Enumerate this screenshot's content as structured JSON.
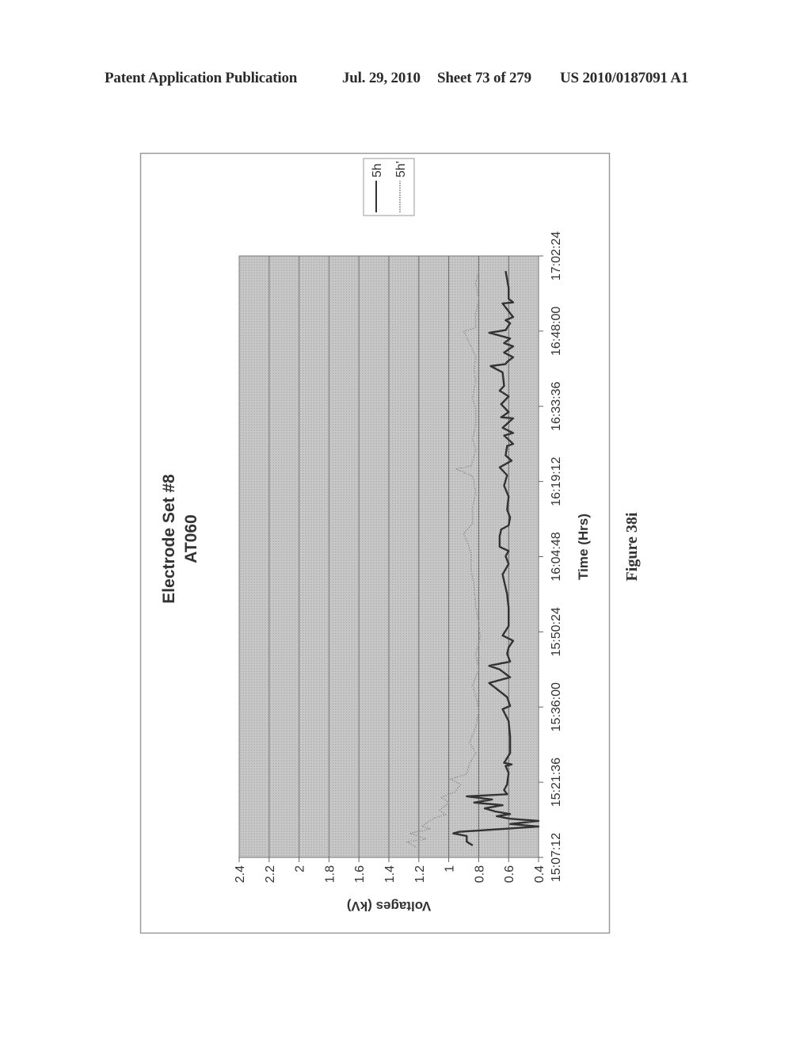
{
  "header": {
    "publication": "Patent Application Publication",
    "date": "Jul. 29, 2010",
    "sheet": "Sheet 73 of 279",
    "number": "US 2010/0187091 A1"
  },
  "figure": {
    "caption": "Figure 38i"
  },
  "chart_data": {
    "type": "line",
    "title": [
      "Electrode Set #8",
      "AT060"
    ],
    "xlabel": "Time (Hrs)",
    "ylabel": "Voltages (kV)",
    "x_origin": "15:07:12",
    "x_unit": "minutes after 15:07:12",
    "xlim": [
      0,
      115.2
    ],
    "x_ticks": [
      {
        "label": "15:07:12",
        "value": 0
      },
      {
        "label": "15:21:36",
        "value": 14.4
      },
      {
        "label": "15:36:00",
        "value": 28.8
      },
      {
        "label": "15:50:24",
        "value": 43.2
      },
      {
        "label": "16:04:48",
        "value": 57.6
      },
      {
        "label": "16:19:12",
        "value": 72.0
      },
      {
        "label": "16:33:36",
        "value": 86.4
      },
      {
        "label": "16:48:00",
        "value": 100.8
      },
      {
        "label": "17:02:24",
        "value": 115.2
      }
    ],
    "ylim": [
      0.4,
      2.4
    ],
    "y_ticks": [
      2.4,
      2.2,
      2,
      1.8,
      1.6,
      1.4,
      1.2,
      1,
      0.8,
      0.6,
      0.4
    ],
    "grid": "horizontal major gridlines",
    "legend": {
      "position": "top-right",
      "entries": [
        "5h",
        "5h'"
      ]
    },
    "series": [
      {
        "name": "5h",
        "style": "solid",
        "color": "#333333",
        "points": [
          [
            2.3,
            0.84
          ],
          [
            3.0,
            0.88
          ],
          [
            4.1,
            0.88
          ],
          [
            4.6,
            0.97
          ],
          [
            4.9,
            0.93
          ],
          [
            5.9,
            0.4
          ],
          [
            6.4,
            0.59
          ],
          [
            7.0,
            0.4
          ],
          [
            7.4,
            0.59
          ],
          [
            7.9,
            0.68
          ],
          [
            8.3,
            0.59
          ],
          [
            8.8,
            0.69
          ],
          [
            9.4,
            0.76
          ],
          [
            10.0,
            0.64
          ],
          [
            10.5,
            0.83
          ],
          [
            11.1,
            0.71
          ],
          [
            11.7,
            0.88
          ],
          [
            12.1,
            0.61
          ],
          [
            12.9,
            0.63
          ],
          [
            14.0,
            0.61
          ],
          [
            16.2,
            0.6
          ],
          [
            17.5,
            0.62
          ],
          [
            17.8,
            0.58
          ],
          [
            18.1,
            0.63
          ],
          [
            20.0,
            0.59
          ],
          [
            23.1,
            0.59
          ],
          [
            26.1,
            0.6
          ],
          [
            28.4,
            0.64
          ],
          [
            29.0,
            0.59
          ],
          [
            30.7,
            0.61
          ],
          [
            33.4,
            0.73
          ],
          [
            34.5,
            0.59
          ],
          [
            36.0,
            0.66
          ],
          [
            36.7,
            0.73
          ],
          [
            37.5,
            0.59
          ],
          [
            39.0,
            0.61
          ],
          [
            40.2,
            0.6
          ],
          [
            41.5,
            0.57
          ],
          [
            42.5,
            0.64
          ],
          [
            44.3,
            0.6
          ],
          [
            47.8,
            0.6
          ],
          [
            50.4,
            0.61
          ],
          [
            54.2,
            0.64
          ],
          [
            56.2,
            0.6
          ],
          [
            57.7,
            0.62
          ],
          [
            58.7,
            0.6
          ],
          [
            59.5,
            0.66
          ],
          [
            61.5,
            0.66
          ],
          [
            62.8,
            0.65
          ],
          [
            63.6,
            0.6
          ],
          [
            65.1,
            0.59
          ],
          [
            66.6,
            0.61
          ],
          [
            69.1,
            0.6
          ],
          [
            71.2,
            0.63
          ],
          [
            73.2,
            0.61
          ],
          [
            74.7,
            0.66
          ],
          [
            76.0,
            0.58
          ],
          [
            77.0,
            0.62
          ],
          [
            78.8,
            0.61
          ],
          [
            79.2,
            0.57
          ],
          [
            80.8,
            0.63
          ],
          [
            81.3,
            0.57
          ],
          [
            82.3,
            0.64
          ],
          [
            84.1,
            0.57
          ],
          [
            84.3,
            0.65
          ],
          [
            85.3,
            0.6
          ],
          [
            86.8,
            0.65
          ],
          [
            88.3,
            0.6
          ],
          [
            89.4,
            0.66
          ],
          [
            90.3,
            0.63
          ],
          [
            92.9,
            0.64
          ],
          [
            94.1,
            0.72
          ],
          [
            94.5,
            0.62
          ],
          [
            94.9,
            0.61
          ],
          [
            95.8,
            0.57
          ],
          [
            96.7,
            0.63
          ],
          [
            97.9,
            0.57
          ],
          [
            98.5,
            0.63
          ],
          [
            99.4,
            0.59
          ],
          [
            100.5,
            0.73
          ],
          [
            101.0,
            0.62
          ],
          [
            102.3,
            0.59
          ],
          [
            102.9,
            0.62
          ],
          [
            103.5,
            0.57
          ],
          [
            106.1,
            0.64
          ],
          [
            106.3,
            0.57
          ],
          [
            107.0,
            0.6
          ],
          [
            109.1,
            0.6
          ],
          [
            110.7,
            0.61
          ],
          [
            112.3,
            0.62
          ]
        ]
      },
      {
        "name": "5h'",
        "style": "dotted",
        "color": "#9a9a9a",
        "points": [
          [
            2.0,
            1.22
          ],
          [
            3.0,
            1.28
          ],
          [
            3.5,
            1.15
          ],
          [
            4.6,
            1.26
          ],
          [
            5.5,
            1.12
          ],
          [
            6.0,
            1.18
          ],
          [
            7.5,
            1.1
          ],
          [
            8.2,
            1.02
          ],
          [
            9.0,
            1.06
          ],
          [
            10.5,
            1.0
          ],
          [
            11.5,
            1.05
          ],
          [
            12.5,
            0.96
          ],
          [
            14.0,
            0.92
          ],
          [
            15.0,
            0.99
          ],
          [
            16.0,
            0.88
          ],
          [
            18.0,
            0.86
          ],
          [
            20.0,
            0.82
          ],
          [
            22.0,
            0.86
          ],
          [
            25.0,
            0.82
          ],
          [
            28.0,
            0.8
          ],
          [
            30.0,
            0.81
          ],
          [
            33.0,
            0.84
          ],
          [
            36.0,
            0.8
          ],
          [
            39.0,
            0.82
          ],
          [
            42.0,
            0.79
          ],
          [
            45.0,
            0.8
          ],
          [
            48.0,
            0.82
          ],
          [
            52.0,
            0.83
          ],
          [
            55.0,
            0.85
          ],
          [
            58.0,
            0.85
          ],
          [
            60.0,
            0.87
          ],
          [
            62.0,
            0.9
          ],
          [
            64.0,
            0.84
          ],
          [
            67.0,
            0.84
          ],
          [
            70.0,
            0.82
          ],
          [
            73.0,
            0.84
          ],
          [
            74.4,
            0.95
          ],
          [
            75.0,
            0.85
          ],
          [
            78.0,
            0.82
          ],
          [
            80.0,
            0.84
          ],
          [
            83.0,
            0.82
          ],
          [
            86.0,
            0.82
          ],
          [
            88.0,
            0.84
          ],
          [
            91.4,
            0.82
          ],
          [
            93.4,
            0.83
          ],
          [
            96.0,
            0.82
          ],
          [
            100.8,
            0.9
          ],
          [
            101.5,
            0.82
          ],
          [
            104.0,
            0.82
          ],
          [
            107.0,
            0.8
          ],
          [
            110.0,
            0.82
          ],
          [
            112.5,
            0.8
          ]
        ]
      }
    ]
  }
}
